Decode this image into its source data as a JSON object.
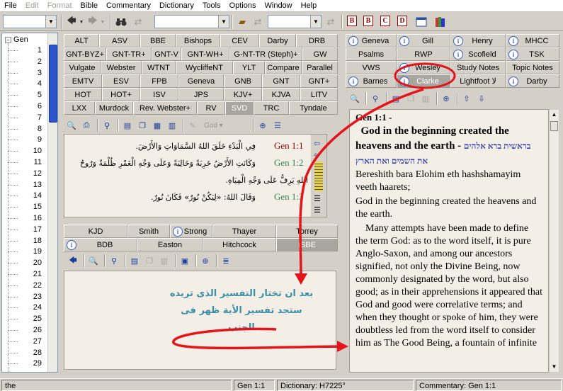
{
  "menu": [
    {
      "label": "File",
      "enabled": true
    },
    {
      "label": "Edit",
      "enabled": false
    },
    {
      "label": "Format",
      "enabled": false
    },
    {
      "label": "Bible",
      "enabled": true
    },
    {
      "label": "Commentary",
      "enabled": true
    },
    {
      "label": "Dictionary",
      "enabled": true
    },
    {
      "label": "Tools",
      "enabled": true
    },
    {
      "label": "Options",
      "enabled": true
    },
    {
      "label": "Window",
      "enabled": true
    },
    {
      "label": "Help",
      "enabled": true
    }
  ],
  "toolbar": {
    "letter_buttons": [
      "B",
      "B",
      "C",
      "D"
    ]
  },
  "tree": {
    "root": "Gen",
    "chapters": [
      "1",
      "2",
      "3",
      "4",
      "5",
      "6",
      "7",
      "8",
      "9",
      "10",
      "11",
      "12",
      "13",
      "14",
      "15",
      "16",
      "17",
      "18",
      "19",
      "20",
      "21",
      "22",
      "23",
      "24",
      "25",
      "26",
      "27",
      "28",
      "29"
    ]
  },
  "bible_tabs": [
    [
      "ALT",
      "ASV",
      "BBE",
      "Bishops",
      "CEV",
      "Darby",
      "DRB"
    ],
    [
      "GNT-BYZ+",
      "GNT-TR+",
      "GNT-V",
      "GNT-WH+",
      "G-NT-TR (Steph)+",
      "GW"
    ],
    [
      "Vulgate",
      "Webster",
      "WTNT",
      "WycliffeNT",
      "YLT",
      "Compare",
      "Parallel"
    ],
    [
      "EMTV",
      "ESV",
      "FPB",
      "Geneva",
      "GNB",
      "GNT",
      "GNT+"
    ],
    [
      "HOT",
      "HOT+",
      "ISV",
      "JPS",
      "KJV+",
      "KJVA",
      "LITV"
    ],
    [
      "LXX",
      "Murdock",
      "Rev. Webster+",
      "RV",
      "SVD",
      "TRC",
      "Tyndale"
    ]
  ],
  "bible_selected": "SVD",
  "bible_tb_dropdown": "God",
  "verses": [
    {
      "ref": "Gen 1:1",
      "text": "فِي الْبَدْءِ خَلَقَ اللهُ السَّمَاوَاتِ وَالأَرْضَ.",
      "color": "#8b0000"
    },
    {
      "ref": "Gen 1:2",
      "text": "وَكَانَتِ الأَرْضُ خَرِبَةً وَخَالِيَةً وَعَلَى وَجْهِ الْغَمْرِ ظُلْمَةٌ وَرُوحُ",
      "color": "#2e8b57"
    },
    {
      "ref": "",
      "text": "اللهِ يَرِفُّ عَلَى وَجْهِ الْمِيَاهِ.",
      "color": "#2e8b57"
    },
    {
      "ref": "Gen 1:3",
      "text": "وَقَالَ اللهُ: «لِيَكُنْ نُورٌ» فَكَانَ نُورٌ.",
      "color": "#2e8b57"
    }
  ],
  "dict_tabs_row1": [
    {
      "label": "KJD",
      "info": false
    },
    {
      "label": "Smith",
      "info": false
    },
    {
      "label": "Strong",
      "info": true
    },
    {
      "label": "Thayer",
      "info": false
    },
    {
      "label": "Torrey",
      "info": false
    }
  ],
  "dict_tabs_row2": [
    {
      "label": "BDB",
      "info": true
    },
    {
      "label": "Easton",
      "info": false
    },
    {
      "label": "Hitchcock",
      "info": false
    },
    {
      "label": "ISBE",
      "info": false
    }
  ],
  "dict_selected": "ISBE",
  "annotation_text": [
    "بعد ان تختار التفسير الذى تريده",
    "ستجد تفسير الأية ظهر فى",
    "الجنب"
  ],
  "comm_tabs": [
    [
      {
        "label": "Geneva",
        "info": true
      },
      {
        "label": "Gill",
        "info": true
      },
      {
        "label": "Henry",
        "info": true
      },
      {
        "label": "MHCC",
        "info": true
      }
    ],
    [
      {
        "label": "Psalms",
        "info": false
      },
      {
        "label": "RWP",
        "info": false
      },
      {
        "label": "Scofield",
        "info": true
      },
      {
        "label": "TSK",
        "info": true
      }
    ],
    [
      {
        "label": "VWS",
        "info": false
      },
      {
        "label": "Wesley",
        "info": true
      },
      {
        "label": "Study Notes",
        "info": false
      },
      {
        "label": "Topic Notes",
        "info": false
      }
    ],
    [
      {
        "label": "Barnes",
        "info": true
      },
      {
        "label": "Clarke",
        "info": true
      },
      {
        "label": "Lightfoot لا",
        "info": false
      },
      {
        "label": "Darby",
        "info": true
      }
    ]
  ],
  "comm_selected": "Clarke",
  "commentary": {
    "ref": "Gen 1:1 -",
    "heading": "God in the beginning created the heavens and the earth -",
    "hebrew": "בראשית ברא אלהים את השמים ואת הארץ",
    "translit": "Bereshith bara Elohim eth hashshamayim veeth haarets;",
    "gloss": "God in the beginning created the heavens and the earth.",
    "body": "Many attempts have been made to define the term God: as to the word itself, it is pure Anglo-Saxon, and among our ancestors signified, not only the Divine Being, now commonly designated by the word, but also good; as in their apprehensions it appeared that God and good were correlative terms; and when they thought or spoke of him, they were doubtless led from the word itself to consider him as The Good Being, a fountain of infinite"
  },
  "status": {
    "left": "the",
    "ref": "Gen 1:1",
    "dict": "Dictionary: H7225°",
    "comm": "Commentary: Gen 1:1"
  },
  "colors": {
    "annotation": "#3d8fa8",
    "arrow": "#e4141b",
    "tree_thumb": "#2b55c9"
  }
}
